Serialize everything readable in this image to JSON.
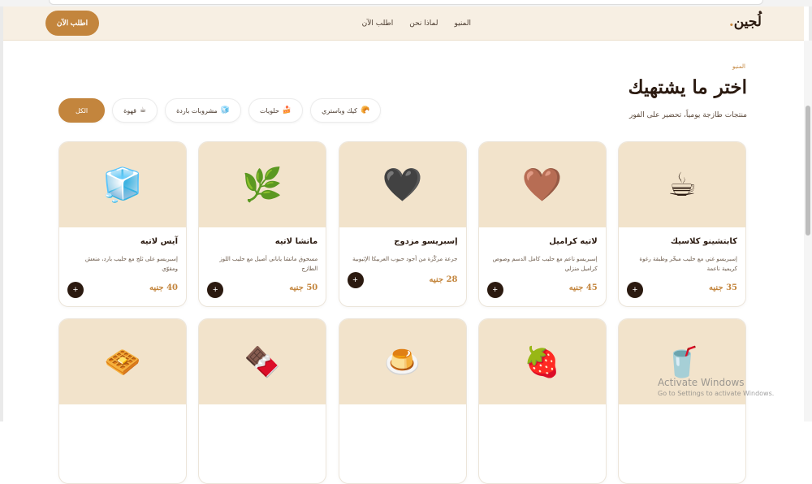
{
  "nav": {
    "logo": "لُجين",
    "logo_dot": ".",
    "links": [
      "المنيو",
      "لماذا نحن",
      "اطلب الآن"
    ],
    "order_button": "اطلب الآن"
  },
  "header": {
    "breadcrumb": "المنيو",
    "title": "اختر ما يشتهيك",
    "subtitle": "منتجات طازجة يومياً، تحضير على الفور"
  },
  "filters": [
    {
      "label": "الكل",
      "icon": "",
      "active": true
    },
    {
      "label": "قهوة",
      "icon": "☕",
      "icon_name": "coffee-icon"
    },
    {
      "label": "مشروبات باردة",
      "icon": "🧊",
      "icon_name": "ice-cube-icon"
    },
    {
      "label": "حلويات",
      "icon": "🍰",
      "icon_name": "cake-icon"
    },
    {
      "label": "كيك وباستري",
      "icon": "🥐",
      "icon_name": "croissant-icon"
    }
  ],
  "products": [
    {
      "name": "كابتشينو كلاسيك",
      "desc": "إسبريسو غني مع حليب مبخّر وطبقة رغوة كريمية ناعمة",
      "price": "35 جنيه",
      "icon": "☕",
      "icon_name": "coffee-cup-icon"
    },
    {
      "name": "لاتيه كراميل",
      "desc": "إسبريسو ناعم مع حليب كامل الدسم وصوص كراميل منزلي",
      "price": "45 جنيه",
      "icon": "🤎",
      "icon_name": "brown-heart-icon"
    },
    {
      "name": "إسبريسو مزدوج",
      "desc": "جرعة مركّزة من أجود حبوب العربيكا الإثيوبية",
      "price": "28 جنيه",
      "icon": "🖤",
      "icon_name": "dark-heart-icon"
    },
    {
      "name": "ماتشا لاتيه",
      "desc": "مسحوق ماتشا ياباني أصيل مع حليب اللوز الطازج",
      "price": "50 جنيه",
      "icon": "🌿",
      "icon_name": "leaf-icon"
    },
    {
      "name": "آيس لاتيه",
      "desc": "إسبريسو على ثلج مع حليب بارد، منعش ومقوّي",
      "price": "40 جنيه",
      "icon": "🧊",
      "icon_name": "ice-cube-icon"
    },
    {
      "name": "",
      "desc": "",
      "price": "",
      "icon": "🥤",
      "icon_name": "milkshake-cup-icon"
    },
    {
      "name": "",
      "desc": "",
      "price": "",
      "icon": "🍓",
      "icon_name": "strawberry-icon"
    },
    {
      "name": "",
      "desc": "",
      "price": "",
      "icon": "🍮",
      "icon_name": "pudding-icon"
    },
    {
      "name": "",
      "desc": "",
      "price": "",
      "icon": "🍫",
      "icon_name": "chocolate-bar-icon"
    },
    {
      "name": "",
      "desc": "",
      "price": "",
      "icon": "🧇",
      "icon_name": "waffle-icon"
    }
  ],
  "add_symbol": "+",
  "watermark": {
    "title": "Activate Windows",
    "subtitle": "Go to Settings to activate Windows."
  }
}
